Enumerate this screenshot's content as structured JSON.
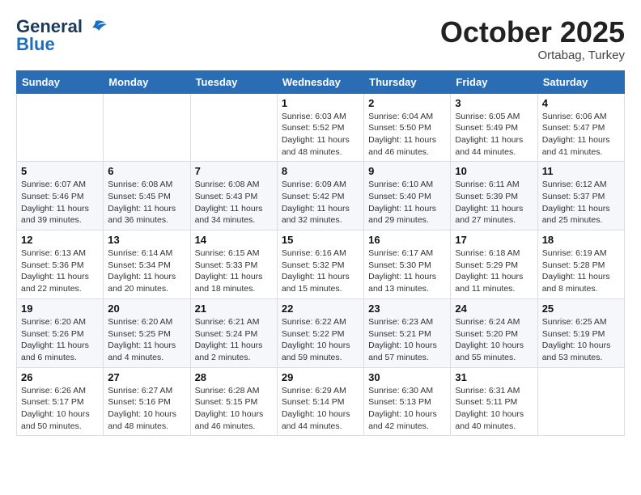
{
  "header": {
    "logo_general": "General",
    "logo_blue": "Blue",
    "month": "October 2025",
    "location": "Ortabag, Turkey"
  },
  "weekdays": [
    "Sunday",
    "Monday",
    "Tuesday",
    "Wednesday",
    "Thursday",
    "Friday",
    "Saturday"
  ],
  "weeks": [
    [
      null,
      null,
      null,
      {
        "day": 1,
        "sunrise": "6:03 AM",
        "sunset": "5:52 PM",
        "daylight": "11 hours and 48 minutes."
      },
      {
        "day": 2,
        "sunrise": "6:04 AM",
        "sunset": "5:50 PM",
        "daylight": "11 hours and 46 minutes."
      },
      {
        "day": 3,
        "sunrise": "6:05 AM",
        "sunset": "5:49 PM",
        "daylight": "11 hours and 44 minutes."
      },
      {
        "day": 4,
        "sunrise": "6:06 AM",
        "sunset": "5:47 PM",
        "daylight": "11 hours and 41 minutes."
      }
    ],
    [
      {
        "day": 5,
        "sunrise": "6:07 AM",
        "sunset": "5:46 PM",
        "daylight": "11 hours and 39 minutes."
      },
      {
        "day": 6,
        "sunrise": "6:08 AM",
        "sunset": "5:45 PM",
        "daylight": "11 hours and 36 minutes."
      },
      {
        "day": 7,
        "sunrise": "6:08 AM",
        "sunset": "5:43 PM",
        "daylight": "11 hours and 34 minutes."
      },
      {
        "day": 8,
        "sunrise": "6:09 AM",
        "sunset": "5:42 PM",
        "daylight": "11 hours and 32 minutes."
      },
      {
        "day": 9,
        "sunrise": "6:10 AM",
        "sunset": "5:40 PM",
        "daylight": "11 hours and 29 minutes."
      },
      {
        "day": 10,
        "sunrise": "6:11 AM",
        "sunset": "5:39 PM",
        "daylight": "11 hours and 27 minutes."
      },
      {
        "day": 11,
        "sunrise": "6:12 AM",
        "sunset": "5:37 PM",
        "daylight": "11 hours and 25 minutes."
      }
    ],
    [
      {
        "day": 12,
        "sunrise": "6:13 AM",
        "sunset": "5:36 PM",
        "daylight": "11 hours and 22 minutes."
      },
      {
        "day": 13,
        "sunrise": "6:14 AM",
        "sunset": "5:34 PM",
        "daylight": "11 hours and 20 minutes."
      },
      {
        "day": 14,
        "sunrise": "6:15 AM",
        "sunset": "5:33 PM",
        "daylight": "11 hours and 18 minutes."
      },
      {
        "day": 15,
        "sunrise": "6:16 AM",
        "sunset": "5:32 PM",
        "daylight": "11 hours and 15 minutes."
      },
      {
        "day": 16,
        "sunrise": "6:17 AM",
        "sunset": "5:30 PM",
        "daylight": "11 hours and 13 minutes."
      },
      {
        "day": 17,
        "sunrise": "6:18 AM",
        "sunset": "5:29 PM",
        "daylight": "11 hours and 11 minutes."
      },
      {
        "day": 18,
        "sunrise": "6:19 AM",
        "sunset": "5:28 PM",
        "daylight": "11 hours and 8 minutes."
      }
    ],
    [
      {
        "day": 19,
        "sunrise": "6:20 AM",
        "sunset": "5:26 PM",
        "daylight": "11 hours and 6 minutes."
      },
      {
        "day": 20,
        "sunrise": "6:20 AM",
        "sunset": "5:25 PM",
        "daylight": "11 hours and 4 minutes."
      },
      {
        "day": 21,
        "sunrise": "6:21 AM",
        "sunset": "5:24 PM",
        "daylight": "11 hours and 2 minutes."
      },
      {
        "day": 22,
        "sunrise": "6:22 AM",
        "sunset": "5:22 PM",
        "daylight": "10 hours and 59 minutes."
      },
      {
        "day": 23,
        "sunrise": "6:23 AM",
        "sunset": "5:21 PM",
        "daylight": "10 hours and 57 minutes."
      },
      {
        "day": 24,
        "sunrise": "6:24 AM",
        "sunset": "5:20 PM",
        "daylight": "10 hours and 55 minutes."
      },
      {
        "day": 25,
        "sunrise": "6:25 AM",
        "sunset": "5:19 PM",
        "daylight": "10 hours and 53 minutes."
      }
    ],
    [
      {
        "day": 26,
        "sunrise": "6:26 AM",
        "sunset": "5:17 PM",
        "daylight": "10 hours and 50 minutes."
      },
      {
        "day": 27,
        "sunrise": "6:27 AM",
        "sunset": "5:16 PM",
        "daylight": "10 hours and 48 minutes."
      },
      {
        "day": 28,
        "sunrise": "6:28 AM",
        "sunset": "5:15 PM",
        "daylight": "10 hours and 46 minutes."
      },
      {
        "day": 29,
        "sunrise": "6:29 AM",
        "sunset": "5:14 PM",
        "daylight": "10 hours and 44 minutes."
      },
      {
        "day": 30,
        "sunrise": "6:30 AM",
        "sunset": "5:13 PM",
        "daylight": "10 hours and 42 minutes."
      },
      {
        "day": 31,
        "sunrise": "6:31 AM",
        "sunset": "5:11 PM",
        "daylight": "10 hours and 40 minutes."
      },
      null
    ]
  ],
  "labels": {
    "sunrise_prefix": "Sunrise: ",
    "sunset_prefix": "Sunset: ",
    "daylight_prefix": "Daylight: "
  }
}
